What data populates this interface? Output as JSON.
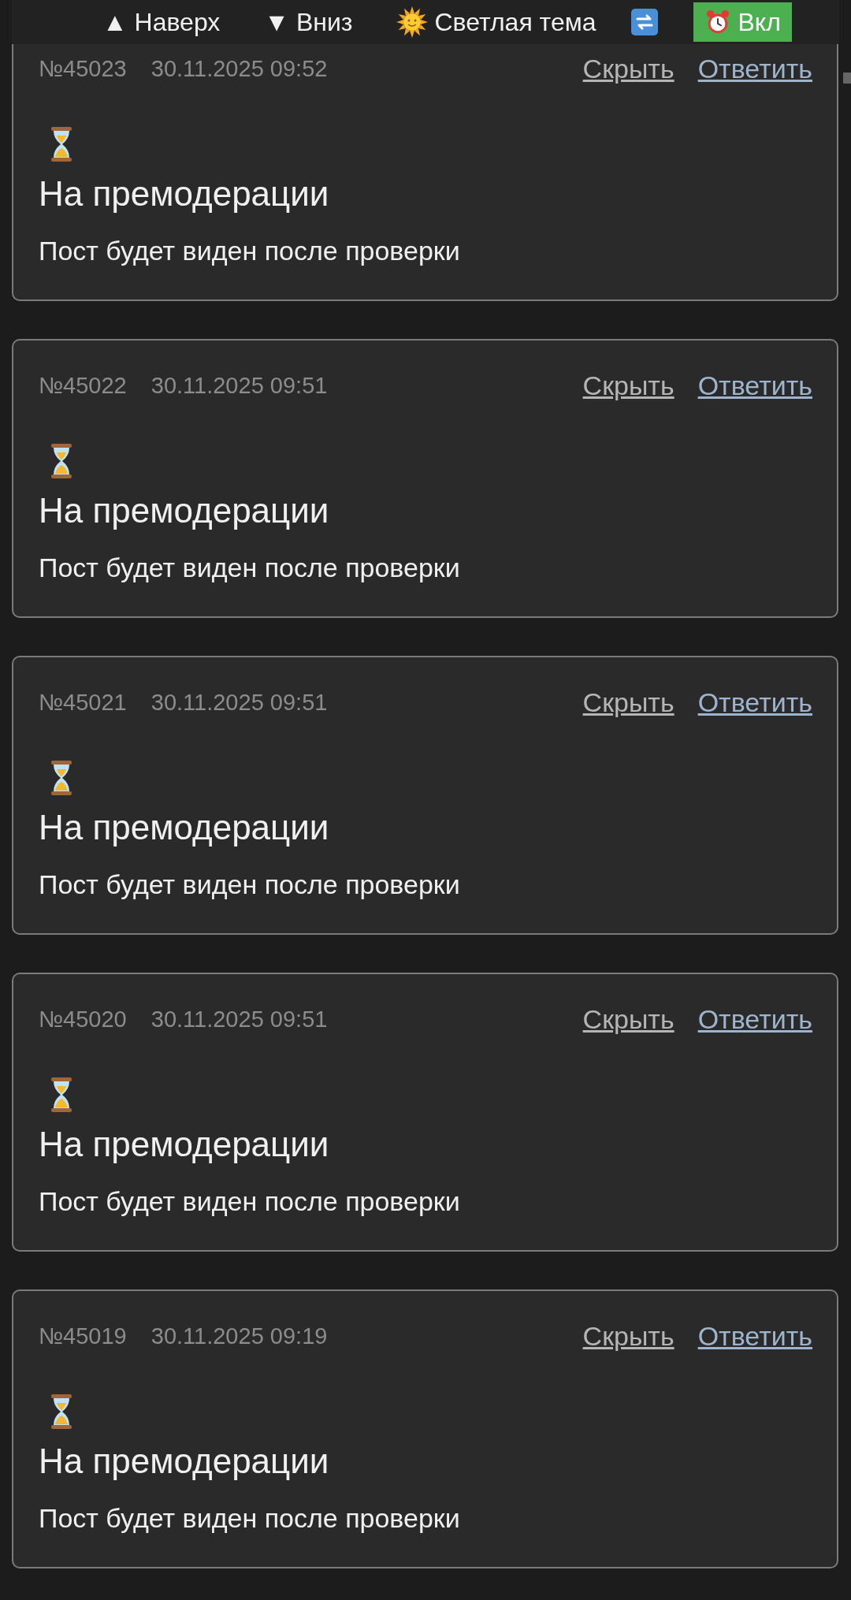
{
  "toolbar": {
    "up": "▲ Наверх",
    "down": "▼ Вниз",
    "theme": "Светлая тема",
    "alarm": {
      "label": "Вкл",
      "on": true
    }
  },
  "posts": [
    {
      "number": "№45023",
      "datetime": "30.11.2025 09:52",
      "hide": "Скрыть",
      "reply": "Ответить",
      "title": "На премодерации",
      "text": "Пост будет виден после проверки"
    },
    {
      "number": "№45022",
      "datetime": "30.11.2025 09:51",
      "hide": "Скрыть",
      "reply": "Ответить",
      "title": "На премодерации",
      "text": "Пост будет виден после проверки"
    },
    {
      "number": "№45021",
      "datetime": "30.11.2025 09:51",
      "hide": "Скрыть",
      "reply": "Ответить",
      "title": "На премодерации",
      "text": "Пост будет виден после проверки"
    },
    {
      "number": "№45020",
      "datetime": "30.11.2025 09:51",
      "hide": "Скрыть",
      "reply": "Ответить",
      "title": "На премодерации",
      "text": "Пост будет виден после проверки"
    },
    {
      "number": "№45019",
      "datetime": "30.11.2025 09:19",
      "hide": "Скрыть",
      "reply": "Ответить",
      "title": "На премодерации",
      "text": "Пост будет виден после проверки"
    }
  ]
}
